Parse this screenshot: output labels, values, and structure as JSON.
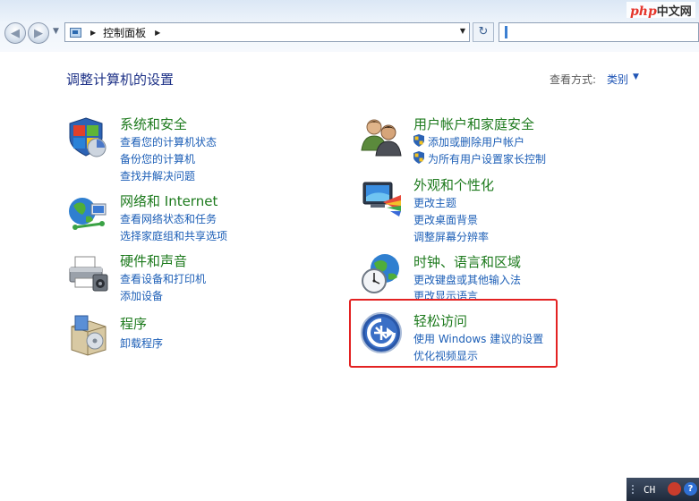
{
  "address": {
    "path_text": "控制面板"
  },
  "watermark": {
    "brand": "php",
    "site": "中文网"
  },
  "header": {
    "title": "调整计算机的设置",
    "view_label": "查看方式:",
    "view_value": "类别"
  },
  "categories": [
    {
      "icon": "shield-windows-icon",
      "title": "系统和安全",
      "links": [
        "查看您的计算机状态",
        "备份您的计算机",
        "查找并解决问题"
      ]
    },
    {
      "icon": "network-globe-icon",
      "title": "网络和 Internet",
      "links": [
        "查看网络状态和任务",
        "选择家庭组和共享选项"
      ]
    },
    {
      "icon": "printer-icon",
      "title": "硬件和声音",
      "links": [
        "查看设备和打印机",
        "添加设备"
      ]
    },
    {
      "icon": "programs-box-icon",
      "title": "程序",
      "links": [
        "卸载程序"
      ]
    },
    {
      "icon": "users-icon",
      "title": "用户帐户和家庭安全",
      "links": [
        "添加或删除用户帐户",
        "为所有用户设置家长控制"
      ]
    },
    {
      "icon": "monitor-personalize-icon",
      "title": "外观和个性化",
      "links": [
        "更改主题",
        "更改桌面背景",
        "调整屏幕分辨率"
      ]
    },
    {
      "icon": "clock-globe-icon",
      "title": "时钟、语言和区域",
      "links": [
        "更改键盘或其他输入法",
        "更改显示语言"
      ]
    },
    {
      "icon": "ease-of-access-icon",
      "title": "轻松访问",
      "links": [
        "使用 Windows 建议的设置",
        "优化视频显示"
      ]
    }
  ],
  "taskbar": {
    "language": "CH"
  },
  "colors": {
    "category_title": "#1d7a1d",
    "link": "#1d5fb7",
    "page_title": "#1e3287",
    "highlight": "#e32222"
  }
}
